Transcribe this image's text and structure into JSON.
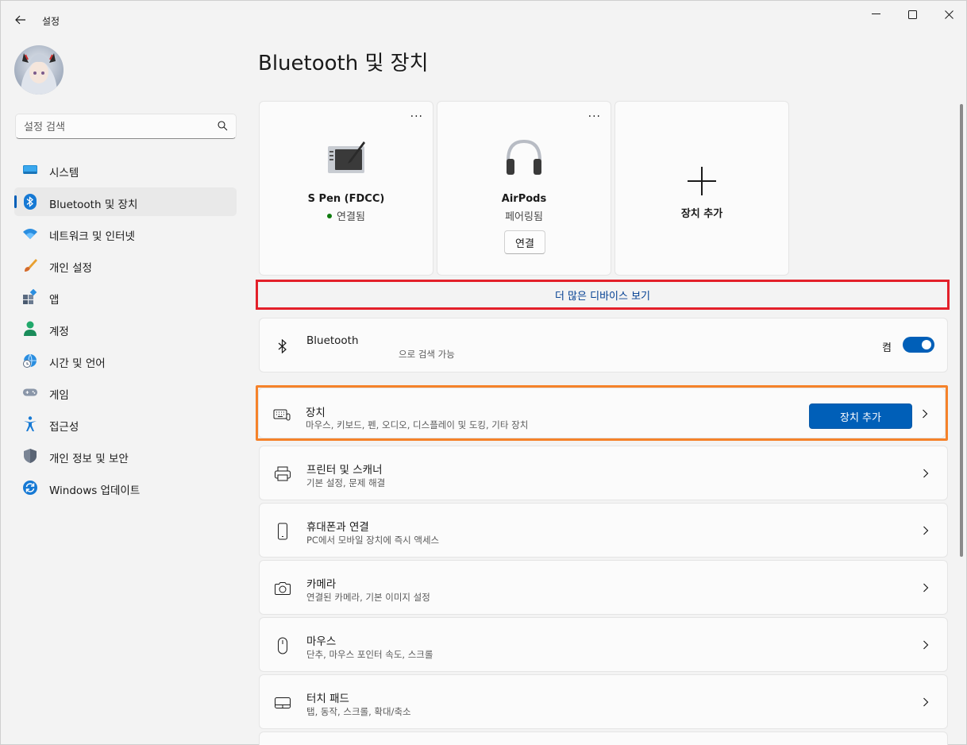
{
  "window": {
    "title": "설정"
  },
  "sidebar": {
    "search_placeholder": "설정 검색",
    "items": [
      {
        "label": "시스템",
        "icon": "monitor-icon"
      },
      {
        "label": "Bluetooth 및 장치",
        "icon": "bluetooth-icon",
        "active": true
      },
      {
        "label": "네트워크 및 인터넷",
        "icon": "wifi-icon"
      },
      {
        "label": "개인 설정",
        "icon": "brush-icon"
      },
      {
        "label": "앱",
        "icon": "apps-icon"
      },
      {
        "label": "계정",
        "icon": "person-icon"
      },
      {
        "label": "시간 및 언어",
        "icon": "globe-clock-icon"
      },
      {
        "label": "게임",
        "icon": "gamepad-icon"
      },
      {
        "label": "접근성",
        "icon": "accessibility-icon"
      },
      {
        "label": "개인 정보 및 보안",
        "icon": "shield-icon"
      },
      {
        "label": "Windows 업데이트",
        "icon": "update-icon"
      }
    ]
  },
  "main": {
    "title": "Bluetooth 및 장치",
    "devices": [
      {
        "name": "S Pen (FDCC)",
        "status": "연결됨",
        "icon": "pen-tablet-icon"
      },
      {
        "name": "AirPods",
        "status": "페어링됨",
        "connect_label": "연결",
        "icon": "headphones-icon"
      }
    ],
    "add_device_card_label": "장치 추가",
    "more_devices_link": "더 많은 디바이스 보기",
    "bluetooth_row": {
      "title": "Bluetooth",
      "subtitle": "으로 검색 가능",
      "toggle_label": "켬",
      "toggle_on": true
    },
    "devices_row": {
      "title": "장치",
      "subtitle": "마우스, 키보드, 펜, 오디오, 디스플레이 및 도킹, 기타 장치",
      "button_label": "장치 추가"
    },
    "rows": [
      {
        "title": "프린터 및 스캐너",
        "subtitle": "기본 설정, 문제 해결",
        "icon": "printer-icon"
      },
      {
        "title": "휴대폰과 연결",
        "subtitle": "PC에서 모바일 장치에 즉시 액세스",
        "icon": "phone-icon"
      },
      {
        "title": "카메라",
        "subtitle": "연결된 카메라, 기본 이미지 설정",
        "icon": "camera-icon"
      },
      {
        "title": "마우스",
        "subtitle": "단추, 마우스 포인터 속도, 스크롤",
        "icon": "mouse-icon"
      },
      {
        "title": "터치 패드",
        "subtitle": "탭, 동작, 스크롤, 확대/축소",
        "icon": "touchpad-icon"
      }
    ]
  },
  "colors": {
    "accent": "#005fb8",
    "red_highlight": "#e3202a",
    "orange_highlight": "#f5822a"
  }
}
